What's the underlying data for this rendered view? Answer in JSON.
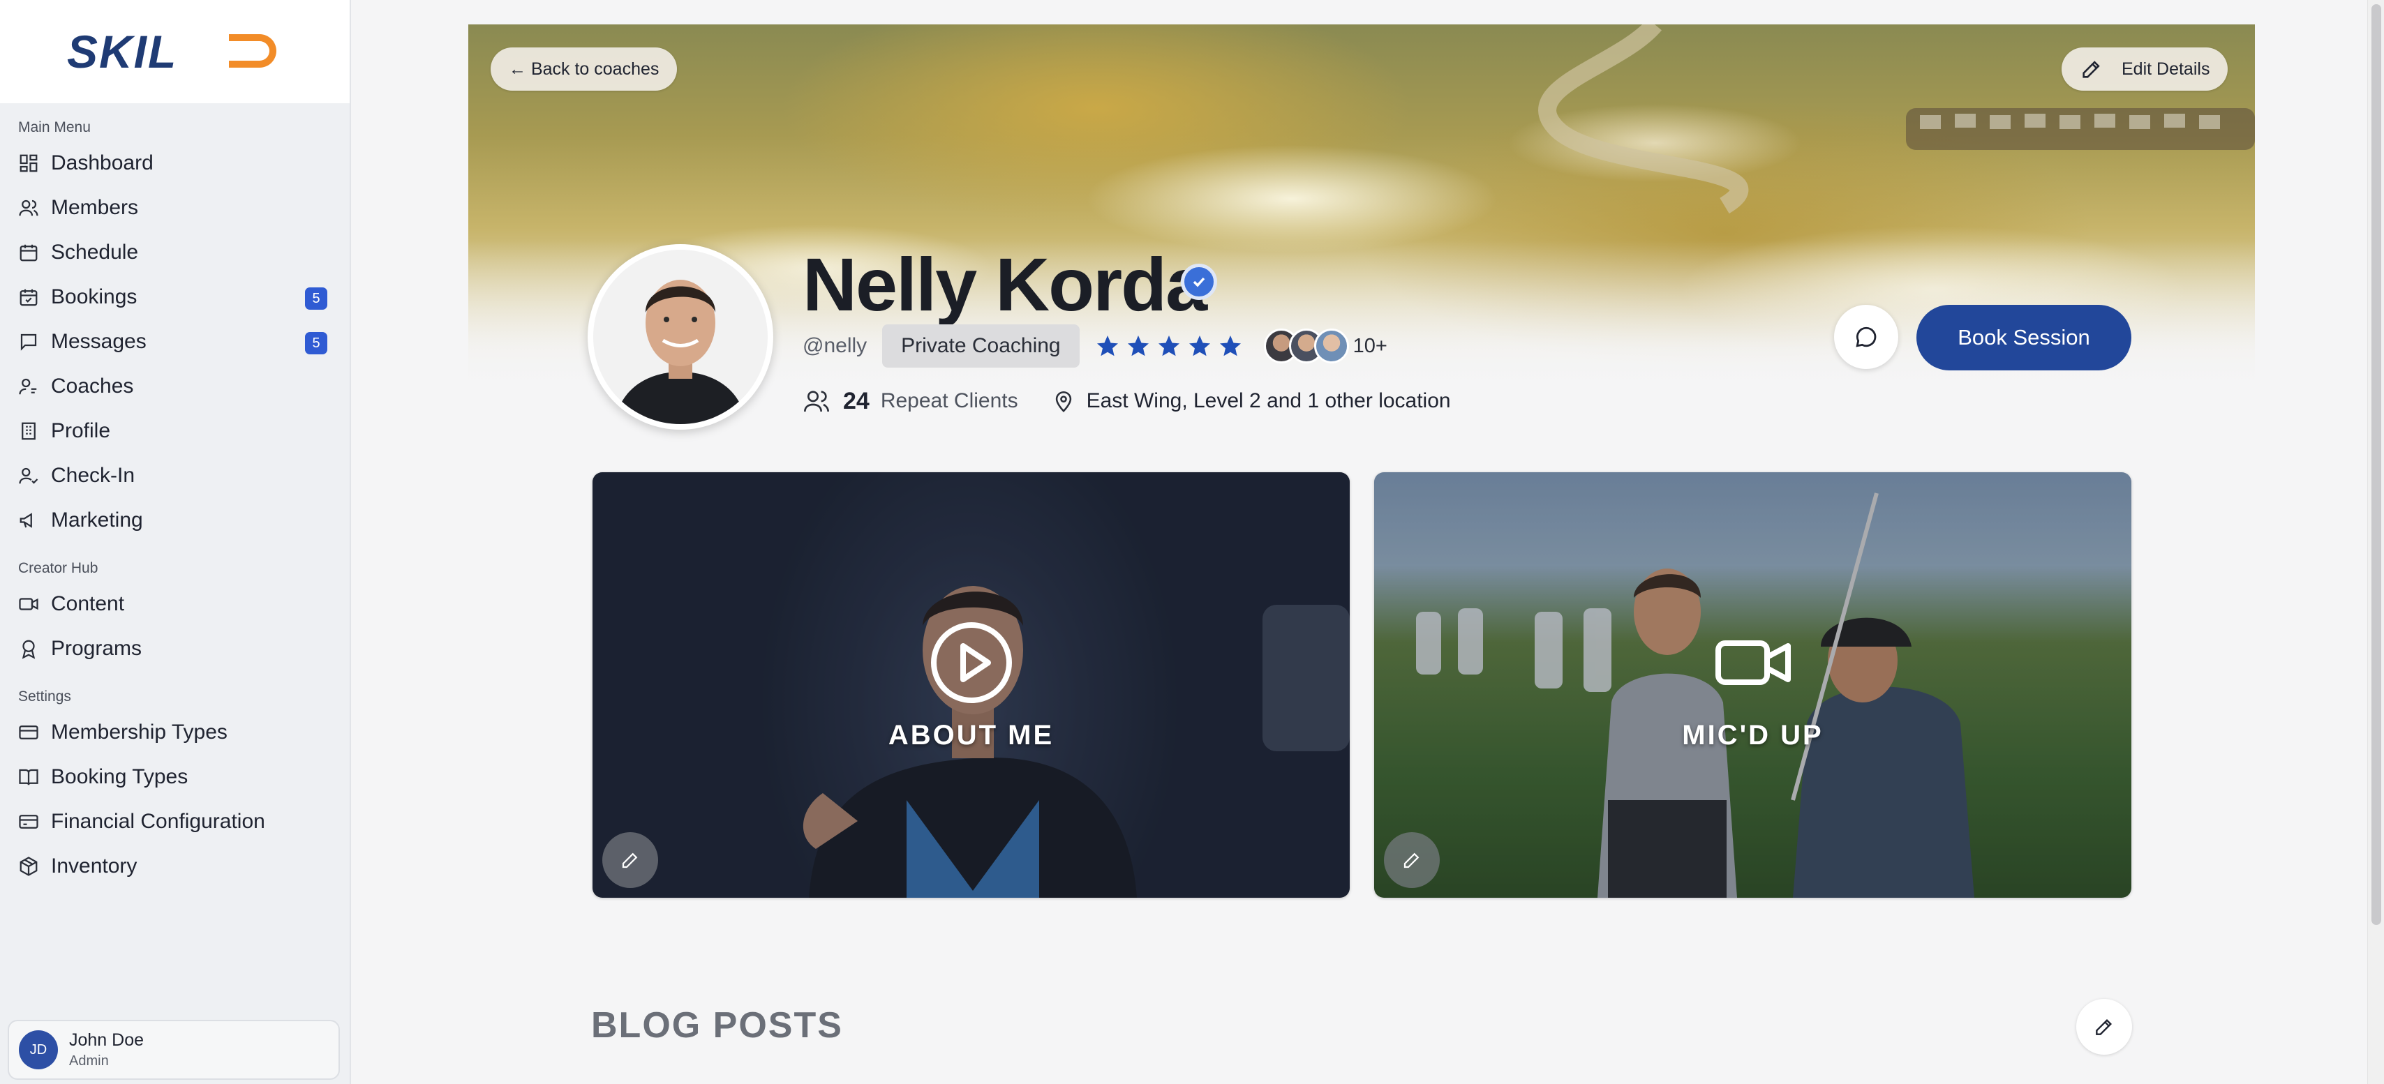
{
  "app": {
    "logo_text": "SKILD",
    "brand_color": "#f28c28",
    "logo_dark": "#1f3b74"
  },
  "sidebar": {
    "sections": [
      {
        "title": "Main Menu",
        "items": [
          {
            "label": "Dashboard",
            "icon": "dashboard-icon"
          },
          {
            "label": "Members",
            "icon": "users-icon"
          },
          {
            "label": "Schedule",
            "icon": "calendar-icon"
          },
          {
            "label": "Bookings",
            "icon": "calendar-check-icon",
            "badge": "5"
          },
          {
            "label": "Messages",
            "icon": "message-icon",
            "badge": "5"
          },
          {
            "label": "Coaches",
            "icon": "coach-icon"
          },
          {
            "label": "Profile",
            "icon": "building-icon"
          },
          {
            "label": "Check-In",
            "icon": "user-check-icon"
          },
          {
            "label": "Marketing",
            "icon": "megaphone-icon"
          }
        ]
      },
      {
        "title": "Creator Hub",
        "items": [
          {
            "label": "Content",
            "icon": "video-icon"
          },
          {
            "label": "Programs",
            "icon": "award-icon"
          }
        ]
      },
      {
        "title": "Settings",
        "items": [
          {
            "label": "Membership Types",
            "icon": "credit-card-icon"
          },
          {
            "label": "Booking Types",
            "icon": "book-icon"
          },
          {
            "label": "Financial Configuration",
            "icon": "wallet-icon"
          },
          {
            "label": "Inventory",
            "icon": "package-icon"
          }
        ]
      }
    ],
    "user": {
      "initials": "JD",
      "name": "John Doe",
      "role": "Admin"
    }
  },
  "hero": {
    "back_label": "← Back to coaches",
    "edit_label": "Edit Details"
  },
  "coach": {
    "name": "Nelly Korda",
    "handle": "@nelly",
    "tag": "Private Coaching",
    "rating": 5,
    "more_clients": "10+",
    "repeat_clients_count": "24",
    "repeat_clients_label": "Repeat Clients",
    "location": "East Wing, Level 2 and 1 other location",
    "book_label": "Book Session"
  },
  "cards": [
    {
      "label": "ABOUT ME",
      "icon": "play-circle-icon"
    },
    {
      "label": "MIC'D UP",
      "icon": "video-camera-icon"
    }
  ],
  "blog": {
    "title": "BLOG POSTS"
  },
  "colors": {
    "accent": "#22479a",
    "badge": "#2f5bd3",
    "star": "#1f4fb8"
  }
}
